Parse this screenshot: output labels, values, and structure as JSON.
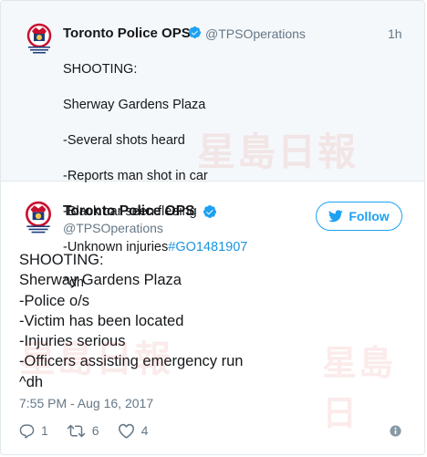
{
  "parent_tweet": {
    "author_name": "Toronto Police OPS",
    "author_handle": "@TPSOperations",
    "time": "1h",
    "lines": [
      "SHOOTING:",
      "Sherway Gardens Plaza",
      "-Several shots heard",
      "-Reports man shot in car",
      "-Black car seen fleeing"
    ],
    "last_line_text": "-Unknown injuries",
    "hashtag": "#GO1481907",
    "signature": "^dh",
    "avatar_caption_1": "TORONTO POLICE",
    "avatar_caption_2": "OPERATIONS",
    "avatar_caption_3": "CENTRE"
  },
  "main_tweet": {
    "author_name": "Toronto Police OPS",
    "author_handle": "@TPSOperations",
    "follow_label": "Follow",
    "text": "SHOOTING:\nSherway Gardens Plaza\n-Police o/s\n-Victim has been located\n-Injuries serious\n-Officers assisting emergency run\n^dh",
    "timestamp": "7:55 PM - Aug 16, 2017",
    "reply_count": "1",
    "retweet_count": "6",
    "like_count": "4",
    "avatar_caption_1": "TORONTO POLICE",
    "avatar_caption_2": "OPERATIONS",
    "avatar_caption_3": "CENTRE"
  },
  "colors": {
    "twitter_blue": "#1da1f2",
    "link_blue": "#1b95e0",
    "muted_gray": "#657786",
    "quoted_bg": "#f5f8fa",
    "border": "#e1e8ed",
    "badge_red": "#c8102e",
    "badge_navy": "#1d3b7c"
  },
  "icons": [
    "verified-badge-icon",
    "twitter-bird-icon",
    "reply-icon",
    "retweet-icon",
    "like-icon",
    "info-icon"
  ]
}
